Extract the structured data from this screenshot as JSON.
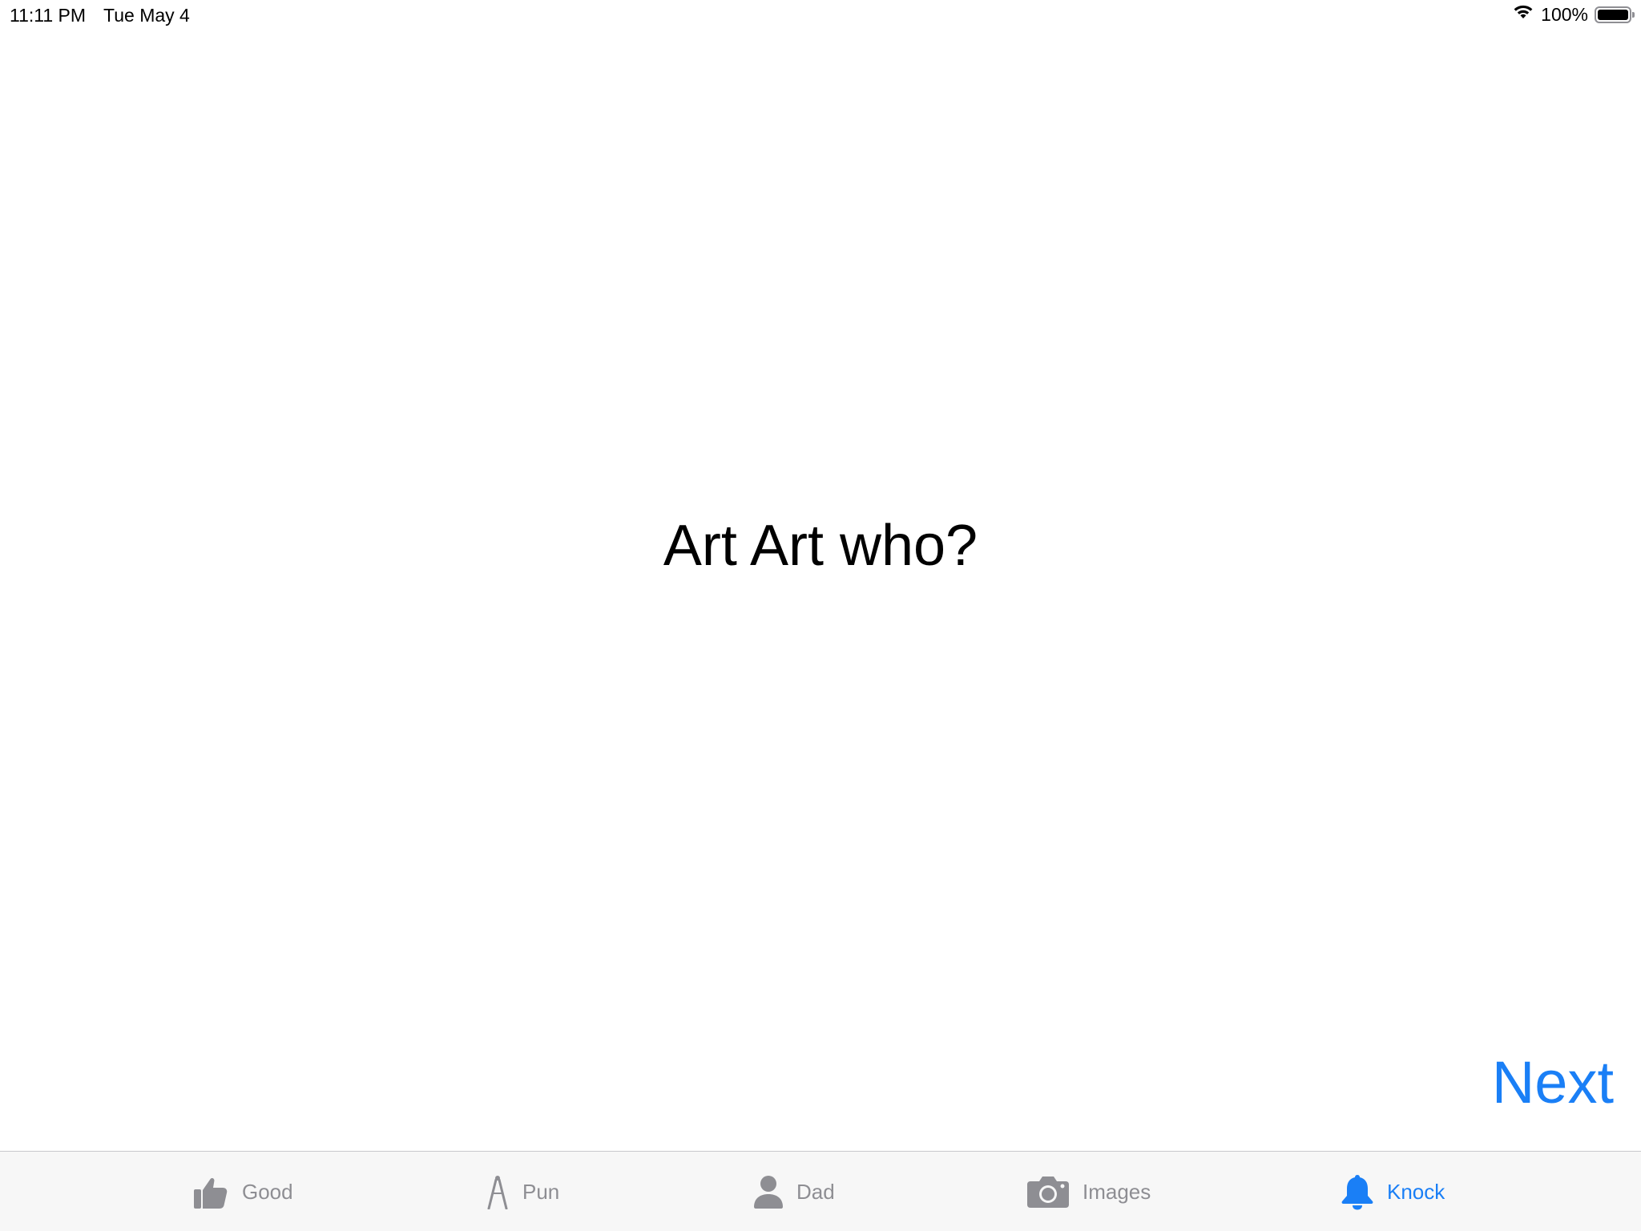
{
  "status_bar": {
    "time": "11:11 PM",
    "date": "Tue May 4",
    "battery_percent": "100%",
    "battery_level": 1.0
  },
  "main": {
    "joke_text": "Art Art who?",
    "next_label": "Next"
  },
  "tab_bar": {
    "items": [
      {
        "label": "Good",
        "icon": "thumbs-up-icon",
        "active": false
      },
      {
        "label": "Pun",
        "icon": "compass-icon",
        "active": false
      },
      {
        "label": "Dad",
        "icon": "person-icon",
        "active": false
      },
      {
        "label": "Images",
        "icon": "camera-icon",
        "active": false
      },
      {
        "label": "Knock",
        "icon": "bell-icon",
        "active": true
      }
    ]
  },
  "colors": {
    "accent": "#1a7ff6",
    "inactive_tab": "#8e8e93",
    "tab_bar_background": "#f7f7f7"
  }
}
